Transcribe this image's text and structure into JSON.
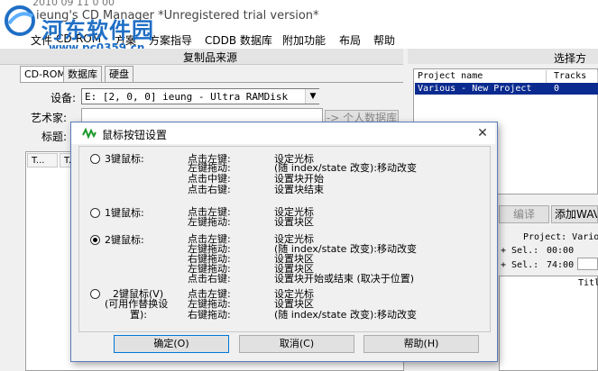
{
  "window": {
    "title": "ieung's CD Manager *Unregistered trial version*",
    "top_partial": "2010 09 11 0 00"
  },
  "watermark": {
    "text": "河东软件园",
    "url": "www.pc0359.cn"
  },
  "menu": [
    "文件",
    "CD-ROM",
    "方案",
    "方案指导",
    "CDDB 数据库",
    "附加功能",
    "布局",
    "帮助"
  ],
  "left_panel": {
    "caption": "复制品来源",
    "tabs": [
      "CD-ROM",
      "数据库",
      "硬盘"
    ],
    "device_label": "设备:",
    "device_value": "E:  [2, 0, 0]  ieung - Ultra RAMDisk",
    "artist_label": "艺术家:",
    "title_label": "标题:",
    "personal_db_button": "-> 个人数据库",
    "list_headers": [
      "T...",
      "T..."
    ]
  },
  "right_panel": {
    "caption": "选择方",
    "columns": [
      "Project name",
      "Tracks"
    ],
    "row": {
      "name": "Various - New Project",
      "tracks": "0"
    },
    "buttons": [
      "编译",
      "添加WAV文"
    ],
    "project_label": "Project: Vario",
    "sel1_label": "+ Sel.:",
    "sel1_value": "00:00",
    "sel2_label": "+ Sel.:",
    "sel2_value": "74:00",
    "col_partial": "Titl"
  },
  "dialog": {
    "title": "鼠标按钮设置",
    "options": [
      {
        "label": "3键鼠标:",
        "checked": false,
        "actions": [
          "点击左键:",
          "左键拖动:",
          "点击中键:",
          "点击右键:"
        ],
        "descs": [
          "设定光标",
          "(随 index/state 改变):移动改变",
          "设置块开始",
          "设置块结束"
        ]
      },
      {
        "label": "1键鼠标:",
        "checked": false,
        "actions": [
          "点击左键:",
          "左键拖动:"
        ],
        "descs": [
          "设定光标",
          "设置块区"
        ]
      },
      {
        "label": "2键鼠标:",
        "checked": true,
        "actions": [
          "点击左键:",
          "左键拖动:",
          "右键拖动:",
          "左键拖动:",
          "点击右键:"
        ],
        "descs": [
          "设定光标",
          "(随 index/state 改变):移动改变",
          "设置块区",
          "设置块区",
          "设置块开始或结束 (取决于位置)"
        ]
      },
      {
        "label_lines": [
          "2键鼠标(V)",
          "(可用作替换设",
          "置):"
        ],
        "checked": false,
        "actions": [
          "点击左键:",
          "左键拖动:",
          "右键拖动:"
        ],
        "descs": [
          "设定光标",
          "设置块区",
          "(随 index/state 改变):移动改变"
        ]
      }
    ],
    "buttons": {
      "ok": "确定(O)",
      "cancel": "取消(C)",
      "help": "帮助(H)"
    }
  }
}
